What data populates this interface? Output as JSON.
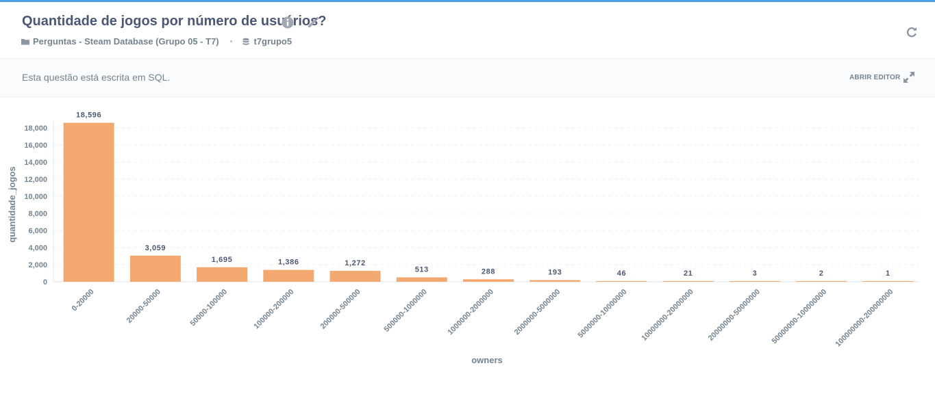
{
  "header": {
    "title": "Quantidade de jogos por número de usuários?",
    "collection": "Perguntas - Steam Database (Grupo 05 - T7)",
    "separator": "•",
    "database": "t7grupo5",
    "icons": [
      "info-icon",
      "pencil-icon",
      "refresh-icon",
      "folder-icon",
      "database-icon"
    ]
  },
  "sql_bar": {
    "text": "Esta questão está escrita em SQL.",
    "open_editor_label": "ABRIR EDITOR",
    "icon": "expand-icon"
  },
  "colors": {
    "accent": "#509ee3",
    "bar": "#f2a86f",
    "text": "#4c5773",
    "muted": "#74838f"
  },
  "chart_data": {
    "type": "bar",
    "xlabel": "owners",
    "ylabel": "quantidade_jogos",
    "ylim": [
      0,
      18000
    ],
    "yticks": [
      0,
      2000,
      4000,
      6000,
      8000,
      10000,
      12000,
      14000,
      16000,
      18000
    ],
    "ytick_labels": [
      "0",
      "2,000",
      "4,000",
      "6,000",
      "8,000",
      "10,000",
      "12,000",
      "14,000",
      "16,000",
      "18,000"
    ],
    "grid": true,
    "categories": [
      "0-20000",
      "20000-50000",
      "50000-100000",
      "100000-200000",
      "200000-500000",
      "500000-1000000",
      "1000000-2000000",
      "2000000-5000000",
      "5000000-10000000",
      "10000000-20000000",
      "20000000-50000000",
      "50000000-100000000",
      "100000000-200000000"
    ],
    "values": [
      18596,
      3059,
      1695,
      1386,
      1272,
      513,
      288,
      193,
      46,
      21,
      3,
      2,
      1
    ],
    "value_labels": [
      "18,596",
      "3,059",
      "1,695",
      "1,386",
      "1,272",
      "513",
      "288",
      "193",
      "46",
      "21",
      "3",
      "2",
      "1"
    ]
  }
}
